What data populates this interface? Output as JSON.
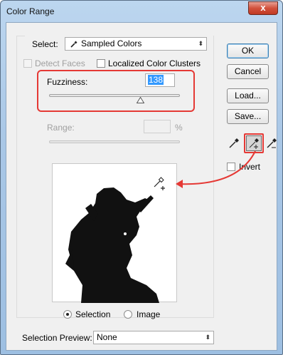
{
  "window": {
    "title": "Color Range",
    "close_label": "x"
  },
  "select": {
    "label": "Select:",
    "value": "Sampled Colors",
    "value_icon": "eyedropper-icon"
  },
  "detect_faces": {
    "label": "Detect Faces",
    "checked": false,
    "enabled": false
  },
  "localized_clusters": {
    "label": "Localized Color Clusters",
    "checked": false
  },
  "fuzziness": {
    "label": "Fuzziness:",
    "value": "138",
    "slider_fraction": 0.69
  },
  "range": {
    "label": "Range:",
    "value": "",
    "unit": "%",
    "enabled": false
  },
  "buttons": {
    "ok": "OK",
    "cancel": "Cancel",
    "load": "Load...",
    "save": "Save..."
  },
  "tools": {
    "eyedropper": "eyedropper-icon",
    "add_to_sample": "eyedropper-plus-icon",
    "subtract_from_sample": "eyedropper-minus-icon"
  },
  "invert": {
    "label": "Invert",
    "checked": false
  },
  "preview_mode": {
    "options": [
      "Selection",
      "Image"
    ],
    "selected": "Selection"
  },
  "selection_preview": {
    "label": "Selection Preview:",
    "value": "None"
  },
  "colors": {
    "highlight": "#e53935",
    "title_bar": "#a9c7e6",
    "selection_blue": "#3399ff"
  }
}
